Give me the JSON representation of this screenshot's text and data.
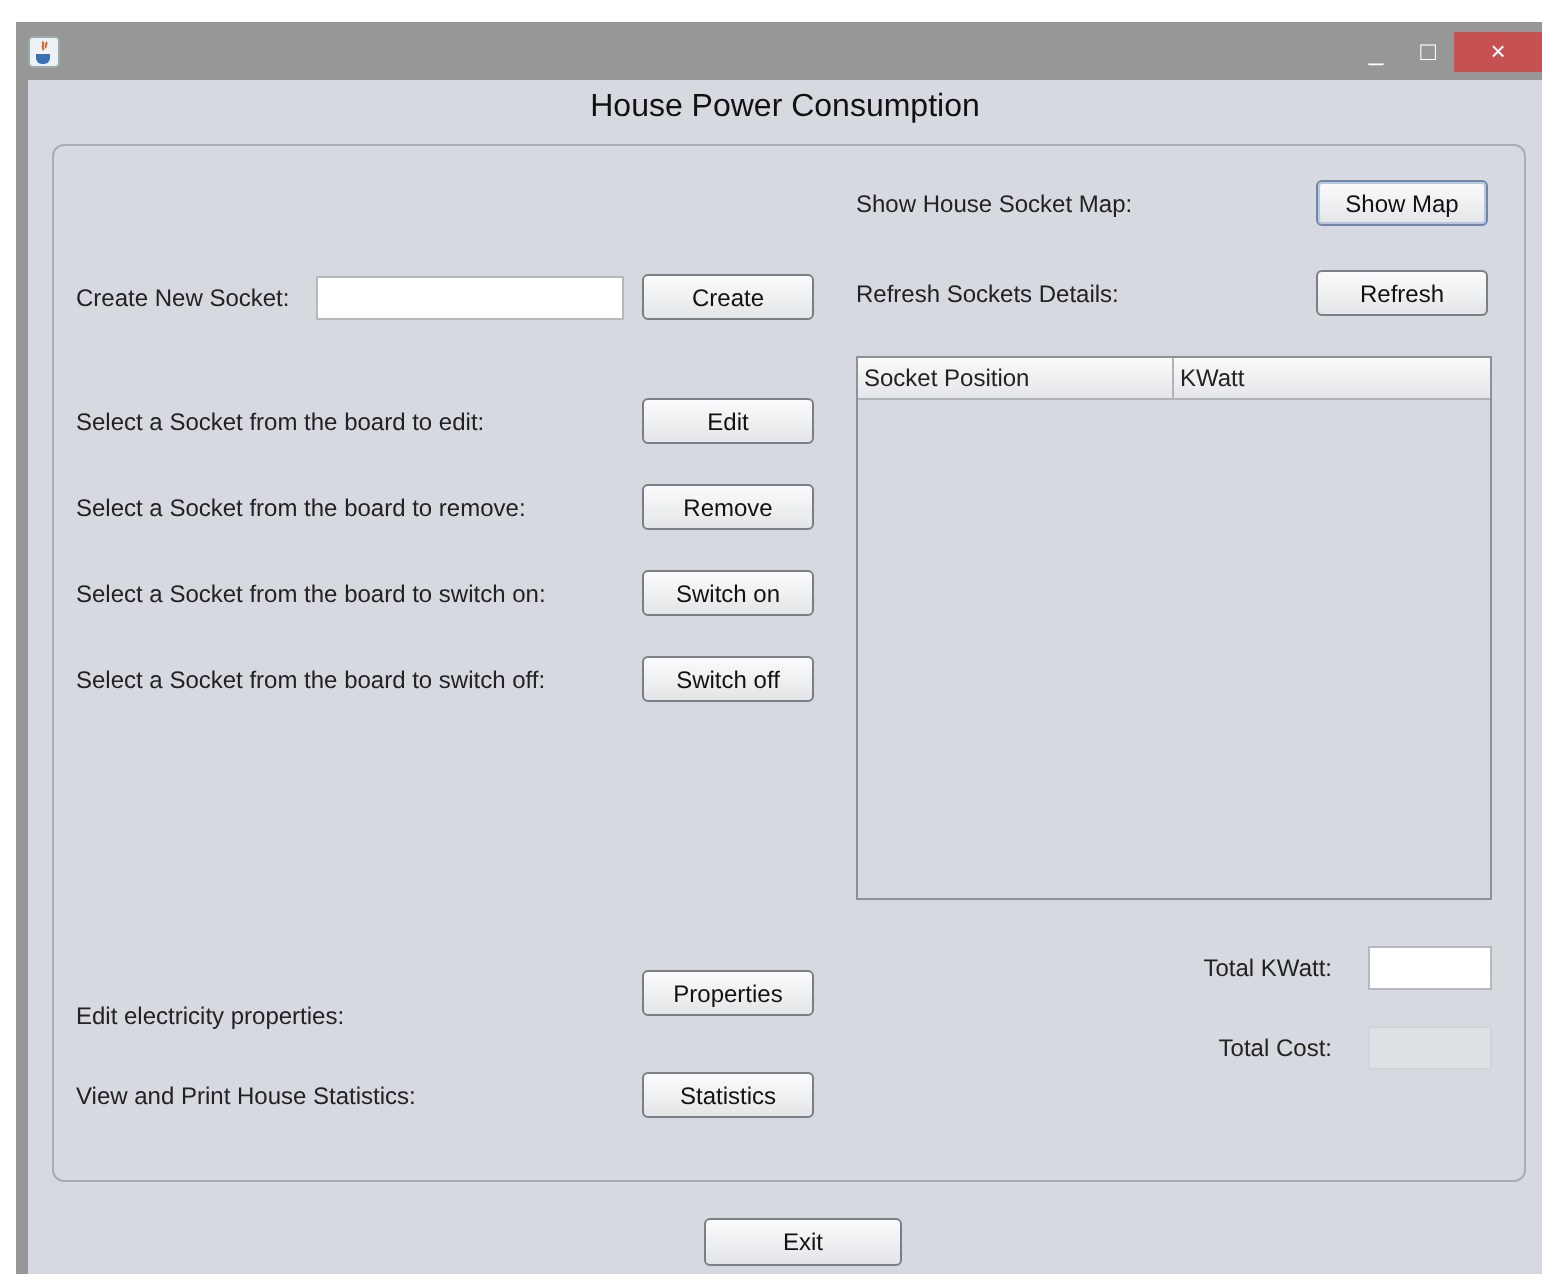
{
  "window": {
    "title": "House Power Consumption",
    "controls": [
      "_",
      "□",
      "×"
    ]
  },
  "left_rows": [
    {
      "kind": "field",
      "label": "Create New Socket:",
      "button": "Create"
    },
    {
      "kind": "plain",
      "label": "Select a Socket from the board to edit:",
      "button": "Edit"
    },
    {
      "kind": "plain",
      "label": "Select a Socket from the board to remove:",
      "button": "Remove"
    },
    {
      "kind": "plain",
      "label": "Select a Socket from the board to switch on:",
      "button": "Switch on"
    },
    {
      "kind": "plain",
      "label": "Select a Socket from the board to switch off:",
      "button": "Switch off"
    }
  ],
  "bottom_rows": [
    {
      "label": "Edit electricity properties:",
      "button": "Properties"
    },
    {
      "label": "View and Print House Statistics:",
      "button": "Statistics"
    }
  ],
  "right_rows": [
    {
      "label": "Show House Socket Map:",
      "button": "Show Map",
      "focused": true
    },
    {
      "label": "Refresh Sockets Details:",
      "button": "Refresh",
      "focused": false
    }
  ],
  "table": {
    "columns": [
      "Socket Position",
      "KWatt"
    ]
  },
  "totals": [
    {
      "label": "Total KWatt:",
      "disabled": false
    },
    {
      "label": "Total Cost:",
      "disabled": true
    }
  ],
  "exit_button": "Exit"
}
